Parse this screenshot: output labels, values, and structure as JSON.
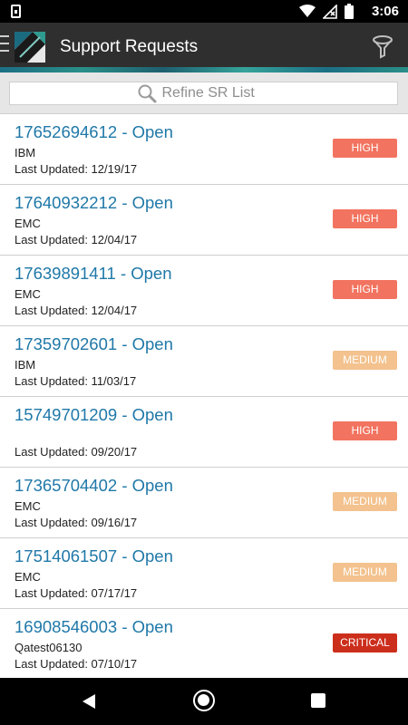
{
  "status_bar": {
    "time": "3:06",
    "icons": [
      "notification-icon",
      "wifi-icon",
      "no-signal-icon",
      "battery-icon"
    ]
  },
  "app_bar": {
    "title": "Support Requests",
    "menu_icon": "menu-icon",
    "logo_icon": "app-logo",
    "filter_icon": "filter-icon"
  },
  "search": {
    "placeholder": "Refine SR List",
    "icon": "search-icon"
  },
  "colors": {
    "high": "#f2735f",
    "medium": "#f3c28e",
    "critical": "#cc2e1c",
    "link_blue": "#1f78a8",
    "app_bar": "#2f2f2f"
  },
  "requests": [
    {
      "title": "17652694612 - Open",
      "company": "IBM",
      "updated": "Last Updated: 12/19/17",
      "severity": "HIGH",
      "level": "high"
    },
    {
      "title": "17640932212 - Open",
      "company": "EMC",
      "updated": "Last Updated: 12/04/17",
      "severity": "HIGH",
      "level": "high"
    },
    {
      "title": "17639891411 - Open",
      "company": "EMC",
      "updated": "Last Updated: 12/04/17",
      "severity": "HIGH",
      "level": "high"
    },
    {
      "title": "17359702601 - Open",
      "company": "IBM",
      "updated": "Last Updated: 11/03/17",
      "severity": "MEDIUM",
      "level": "medium"
    },
    {
      "title": "15749701209 - Open",
      "company": "",
      "updated": "Last Updated: 09/20/17",
      "severity": "HIGH",
      "level": "high"
    },
    {
      "title": "17365704402 - Open",
      "company": "EMC",
      "updated": "Last Updated: 09/16/17",
      "severity": "MEDIUM",
      "level": "medium"
    },
    {
      "title": "17514061507 - Open",
      "company": "EMC",
      "updated": "Last Updated: 07/17/17",
      "severity": "MEDIUM",
      "level": "medium"
    },
    {
      "title": "16908546003 - Open",
      "company": "Qatest06130",
      "updated": "Last Updated: 07/10/17",
      "severity": "CRITICAL",
      "level": "critical"
    }
  ],
  "nav_bar": {
    "back_icon": "back-icon",
    "home_icon": "home-icon",
    "recents_icon": "recents-icon"
  }
}
